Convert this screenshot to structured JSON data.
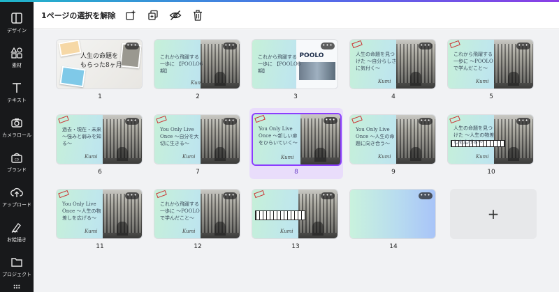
{
  "sidebar": {
    "items": [
      {
        "label": "デザイン",
        "icon": "layout-icon"
      },
      {
        "label": "素材",
        "icon": "shapes-icon"
      },
      {
        "label": "テキスト",
        "icon": "text-icon"
      },
      {
        "label": "カメラロール",
        "icon": "camera-icon"
      },
      {
        "label": "ブランド",
        "icon": "brand-icon"
      },
      {
        "label": "アップロード",
        "icon": "upload-icon"
      },
      {
        "label": "お絵描き",
        "icon": "draw-icon"
      },
      {
        "label": "プロジェクト",
        "icon": "folder-icon"
      }
    ]
  },
  "toolbar": {
    "deselect_label": "1ページの選択を解除"
  },
  "pages": [
    {
      "number": "1",
      "caption": "人生の命題を もらった8ヶ月"
    },
    {
      "number": "2",
      "caption": "これから飛躍する一歩に 【POOLO6期】",
      "signature": "Kumi"
    },
    {
      "number": "3",
      "caption": "これから飛躍する一歩に 【POOLO6期】",
      "logo": "POOLO"
    },
    {
      "number": "4",
      "caption": "人生の命題を見つけた ～自分らしさに気付く～",
      "signature": "Kumi"
    },
    {
      "number": "5",
      "caption": "これから飛躍する一歩に ～POOLOで学んだこと～",
      "signature": "Kumi"
    },
    {
      "number": "6",
      "caption": "過去・現在・未来 ～強みと弱みを知る～",
      "signature": "Kumi"
    },
    {
      "number": "7",
      "caption": "You Only Live Once ～自分を大切に生きる～",
      "signature": "Kumi"
    },
    {
      "number": "8",
      "caption": "You Only Live Once ～新しい扉をひらいていく～",
      "signature": "Kumi"
    },
    {
      "number": "9",
      "caption": "You Only Live Once ～人生の命題に向き合う～",
      "signature": "Kumi"
    },
    {
      "number": "10",
      "caption": "人生の命題を見つけた ～人生の物差しを広げる～",
      "signature": "Kumi"
    },
    {
      "number": "11",
      "caption": "You Only Live Once ～人生の物差しを広げる～",
      "signature": "Kumi"
    },
    {
      "number": "12",
      "caption": "これから飛躍する一歩に ～POOLOで学んだこと～",
      "signature": "Kumi"
    },
    {
      "number": "13",
      "caption": "",
      "signature": "Kumi"
    },
    {
      "number": "14",
      "caption": ""
    }
  ],
  "more_label": "•••",
  "add_page_label": "+",
  "selected_page": "8"
}
